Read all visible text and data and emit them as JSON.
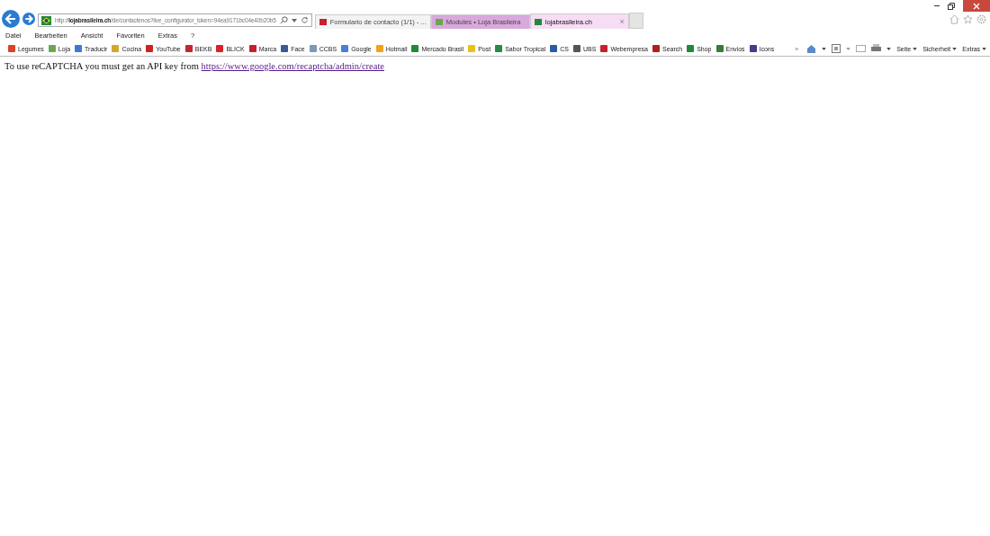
{
  "address_bar": {
    "prefix": "http://",
    "domain": "lojabrasileira.ch",
    "path": "/de/contactenos?live_configurator_token=94ea9171bc04e40b20b5"
  },
  "tabs": [
    {
      "label": "Formulario de contacto (1/1) - ...",
      "selected": false,
      "color": "#f3f3f3"
    },
    {
      "label": "Modules • Loja Brasileira",
      "selected": false,
      "color": "#d9a8dc"
    },
    {
      "label": "lojabrasileira.ch",
      "selected": true,
      "color": "#f6dcf5",
      "close": "×"
    }
  ],
  "menu": [
    "Datei",
    "Bearbeiten",
    "Ansicht",
    "Favoriten",
    "Extras",
    "?"
  ],
  "favorites": [
    {
      "label": "Legumes",
      "color": "#d9432a"
    },
    {
      "label": "Loja",
      "color": "#6aa84f"
    },
    {
      "label": "Traducir",
      "color": "#3c78d8"
    },
    {
      "label": "Cocina",
      "color": "#d4a72c"
    },
    {
      "label": "YouTube",
      "color": "#cc2222"
    },
    {
      "label": "BEKB",
      "color": "#c0282d"
    },
    {
      "label": "BLICK",
      "color": "#d8222a"
    },
    {
      "label": "Marca",
      "color": "#c8202a"
    },
    {
      "label": "Face",
      "color": "#3b5998"
    },
    {
      "label": "CCBS",
      "color": "#7a9bb8"
    },
    {
      "label": "Google",
      "color": "#4a7fd8"
    },
    {
      "label": "Hotmail",
      "color": "#f2a21a"
    },
    {
      "label": "Mercado Brasil",
      "color": "#1f8a3a"
    },
    {
      "label": "Post",
      "color": "#e8c21a"
    },
    {
      "label": "Sabor Tropical",
      "color": "#2a8a4a"
    },
    {
      "label": "CS",
      "color": "#2a5aa8"
    },
    {
      "label": "UBS",
      "color": "#555555"
    },
    {
      "label": "Webempresa",
      "color": "#c8202a"
    },
    {
      "label": "Search",
      "color": "#b02020"
    },
    {
      "label": "Shop",
      "color": "#1f8a3a"
    },
    {
      "label": "Envios",
      "color": "#3a7a3a"
    },
    {
      "label": "Icons",
      "color": "#4a3a8a"
    }
  ],
  "chevron": "»",
  "command_bar": [
    "Seite",
    "Sicherheit",
    "Extras"
  ],
  "content": {
    "text": "To use reCAPTCHA you must get an API key from",
    "link": "https://www.google.com/recaptcha/admin/create"
  }
}
